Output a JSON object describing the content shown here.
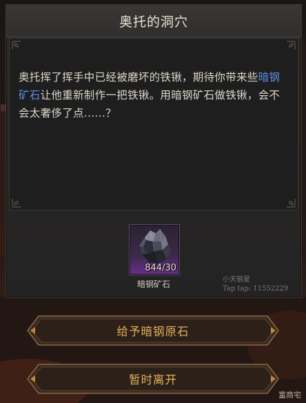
{
  "dialog": {
    "title": "奥托的洞穴",
    "description_parts": {
      "before": "奥托挥了挥手中已经被磨坏的铁锹，期待你带来些",
      "highlight": "暗钢矿石",
      "after": "让他重新制作一把铁锹。用暗钢矿石做铁锹，会不会太奢侈了点......？"
    },
    "highlight_color": "#5a8ee8"
  },
  "item": {
    "icon": "dark-steel-ore-icon",
    "count": "844/30",
    "name": "暗钢矿石"
  },
  "watermark": {
    "line1": "小天狼星",
    "line2": "Tap tap: 11552229"
  },
  "buttons": {
    "give_label": "给予暗钢原石",
    "leave_label": "暂时离开"
  },
  "background": {
    "corner_text": "富商宅",
    "side_text": "部"
  },
  "colors": {
    "button_text": "#e2b15a",
    "title_text": "#e9e3d6",
    "body_text": "#dcd6cc"
  }
}
